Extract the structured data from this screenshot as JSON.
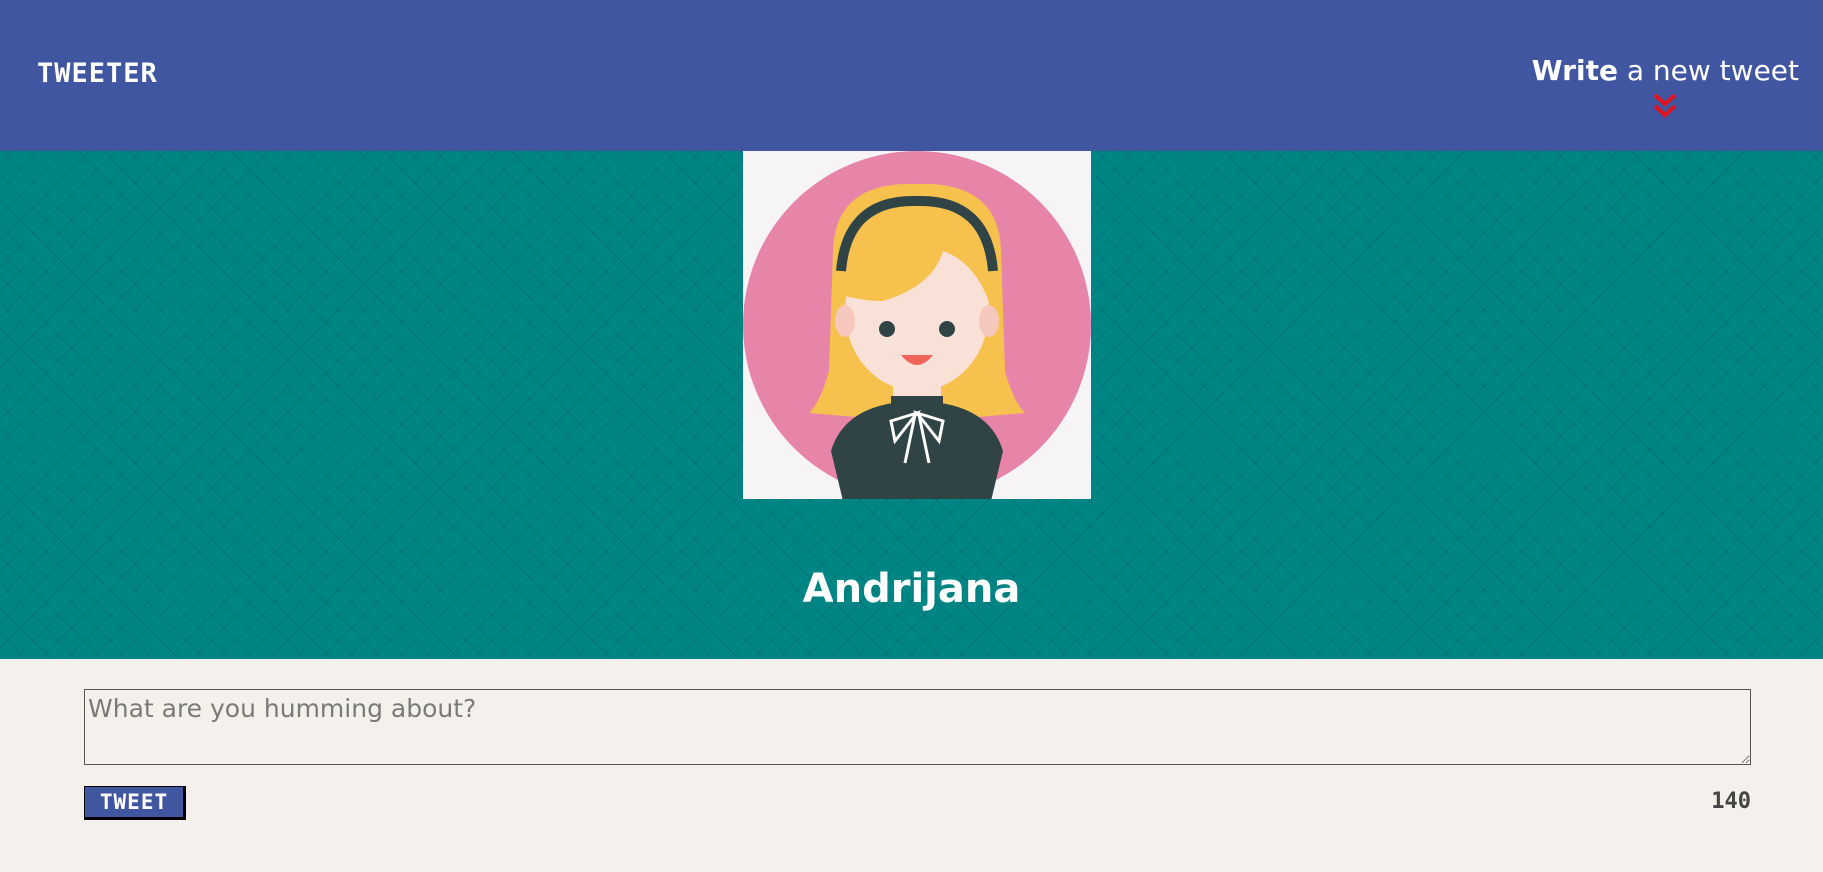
{
  "nav": {
    "brand": "TWEETER",
    "compose_bold": "Write",
    "compose_rest": " a new tweet",
    "chevron_icon": "double-chevron-down-icon"
  },
  "profile": {
    "name": "Andrijana",
    "avatar_icon": "user-avatar-icon"
  },
  "compose": {
    "placeholder": "What are you humming about?",
    "value": "",
    "button_label": "TWEET",
    "char_count": "140"
  },
  "colors": {
    "nav_bg": "#4056a1",
    "banner_bg": "#008585",
    "page_bg": "#f4f1ec",
    "chevron": "#e0121b"
  }
}
